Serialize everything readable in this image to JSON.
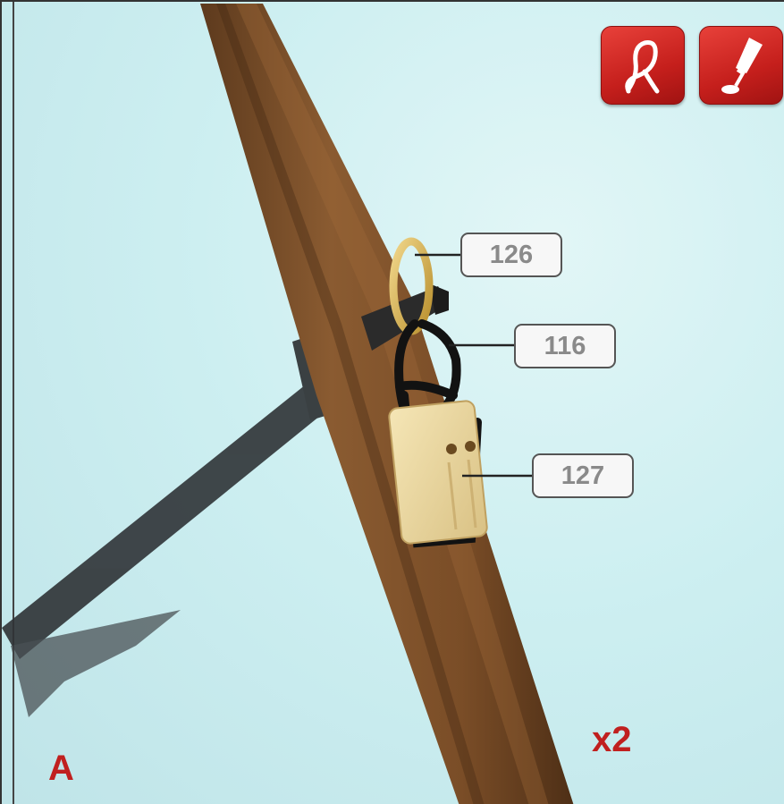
{
  "parts": {
    "ring": "126",
    "rope": "116",
    "block": "127"
  },
  "icons": {
    "first": "rope-knot-icon",
    "second": "glue-bottle-icon"
  },
  "step_letter": "A",
  "quantity": "x2",
  "colors": {
    "accent_red": "#c0201f",
    "label_text": "#8a8a8a"
  }
}
